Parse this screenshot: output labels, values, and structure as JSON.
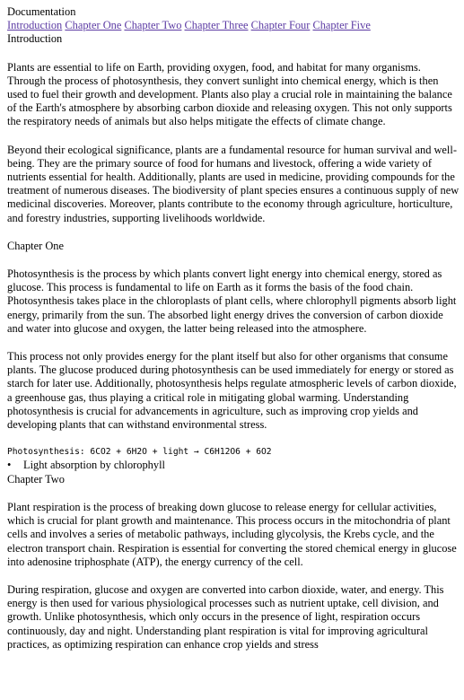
{
  "page_title": "Documentation",
  "nav": {
    "links": [
      "Introduction",
      "Chapter One",
      "Chapter Two",
      "Chapter Three",
      "Chapter Four",
      "Chapter Five"
    ]
  },
  "intro": {
    "heading": "Introduction",
    "paragraphs": [
      "Plants are essential to life on Earth, providing oxygen, food, and habitat for many organisms. Through the process of photosynthesis, they convert sunlight into chemical energy, which is then used to fuel their growth and development. Plants also play a crucial role in maintaining the balance of the Earth's atmosphere by absorbing carbon dioxide and releasing oxygen. This not only supports the respiratory needs of animals but also helps mitigate the effects of climate change.",
      "Beyond their ecological significance, plants are a fundamental resource for human survival and well-being. They are the primary source of food for humans and livestock, offering a wide variety of nutrients essential for health. Additionally, plants are used in medicine, providing compounds for the treatment of numerous diseases. The biodiversity of plant species ensures a continuous supply of new medicinal discoveries. Moreover, plants contribute to the economy through agriculture, horticulture, and forestry industries, supporting livelihoods worldwide."
    ]
  },
  "chapter_one": {
    "heading": "Chapter One",
    "paragraphs": [
      "Photosynthesis is the process by which plants convert light energy into chemical energy, stored as glucose. This process is fundamental to life on Earth as it forms the basis of the food chain. Photosynthesis takes place in the chloroplasts of plant cells, where chlorophyll pigments absorb light energy, primarily from the sun. The absorbed light energy drives the conversion of carbon dioxide and water into glucose and oxygen, the latter being released into the atmosphere.",
      "This process not only provides energy for the plant itself but also for other organisms that consume plants. The glucose produced during photosynthesis can be used immediately for energy or stored as starch for later use. Additionally, photosynthesis helps regulate atmospheric levels of carbon dioxide, a greenhouse gas, thus playing a critical role in mitigating global warming. Understanding photosynthesis is crucial for advancements in agriculture, such as improving crop yields and developing plants that can withstand environmental stress."
    ],
    "formula": "Photosynthesis: 6CO2 + 6H2O + light → C6H12O6 + 6O2",
    "bullet_symbol": "•",
    "bullets": [
      "Light absorption by chlorophyll"
    ]
  },
  "chapter_two": {
    "heading": "Chapter Two",
    "paragraphs": [
      "Plant respiration is the process of breaking down glucose to release energy for cellular activities, which is crucial for plant growth and maintenance. This process occurs in the mitochondria of plant cells and involves a series of metabolic pathways, including glycolysis, the Krebs cycle, and the electron transport chain. Respiration is essential for converting the stored chemical energy in glucose into adenosine triphosphate (ATP), the energy currency of the cell.",
      "During respiration, glucose and oxygen are converted into carbon dioxide, water, and energy. This energy is then used for various physiological processes such as nutrient uptake, cell division, and growth. Unlike photosynthesis, which only occurs in the presence of light, respiration occurs continuously, day and night. Understanding plant respiration is vital for improving agricultural practices, as optimizing respiration can enhance crop yields and stress"
    ]
  },
  "colors": {
    "link": "#5b3aa3",
    "text": "#000000",
    "background": "#ffffff"
  }
}
